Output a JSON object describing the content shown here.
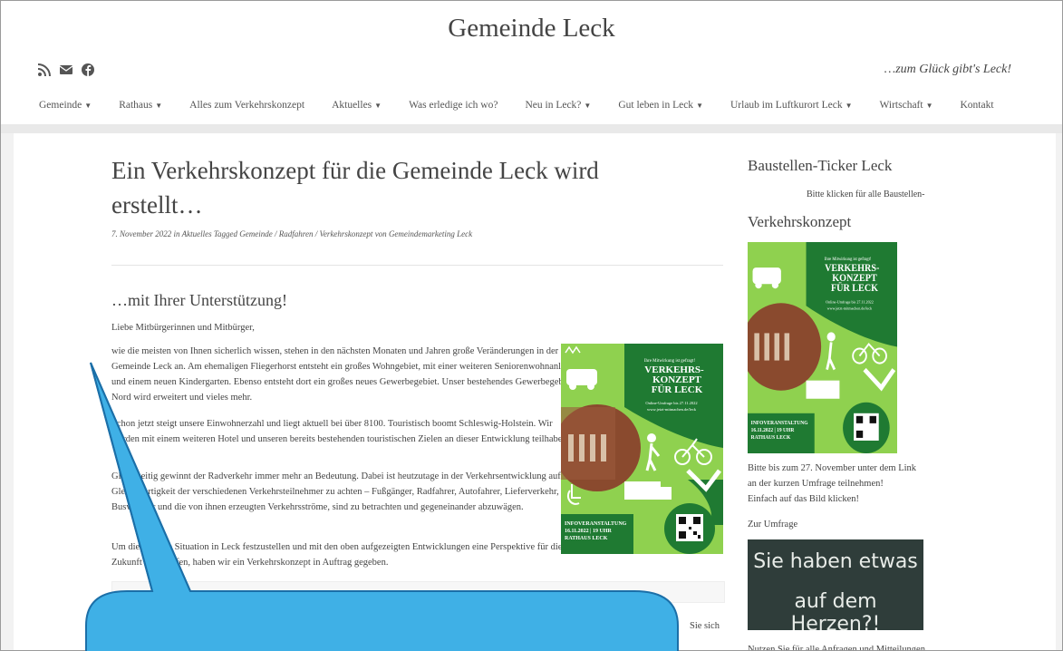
{
  "site": {
    "title": "Gemeinde Leck",
    "slogan": "…zum Glück gibt's Leck!"
  },
  "social": {
    "icons": [
      "rss-icon",
      "mail-icon",
      "facebook-icon"
    ]
  },
  "nav": [
    {
      "label": "Gemeinde",
      "dropdown": true
    },
    {
      "label": "Rathaus",
      "dropdown": true
    },
    {
      "label": "Alles zum Verkehrskonzept",
      "dropdown": false
    },
    {
      "label": "Aktuelles",
      "dropdown": true
    },
    {
      "label": "Was erledige ich wo?",
      "dropdown": false
    },
    {
      "label": "Neu in Leck?",
      "dropdown": true
    },
    {
      "label": "Gut leben in Leck",
      "dropdown": true
    },
    {
      "label": "Urlaub im Luftkurort Leck",
      "dropdown": true
    },
    {
      "label": "Wirtschaft",
      "dropdown": true
    },
    {
      "label": "Kontakt",
      "dropdown": false
    }
  ],
  "post": {
    "title": "Ein Verkehrskonzept für die Gemeinde Leck wird erstellt…",
    "meta": {
      "date": "7. November 2022",
      "in_label": "in",
      "category": "Aktuelles",
      "tagged_label": "Tagged",
      "tags": "Gemeinde / Radfahren / Verkehrskonzept",
      "by_label": "von",
      "author": "Gemeindemarketing Leck"
    },
    "subheading": "…mit Ihrer Unterstützung!",
    "greeting": "Liebe Mitbürgerinnen und Mitbürger,",
    "p1": "wie die meisten von Ihnen sicherlich wissen, stehen in den nächsten Monaten und Jahren große Veränderungen in der Gemeinde Leck an. Am ehemaligen Fliegerhorst entsteht ein großes Wohngebiet, mit einer weiteren Seniorenwohnanlage und einem neuen Kindergarten. Ebenso entsteht dort ein großes neues Gewerbegebiet. Unser bestehendes Gewerbegebiet Nord wird erweitert und vieles mehr.",
    "p2": "Schon jetzt steigt unsere Einwohnerzahl und liegt aktuell bei über 8100. Touristisch boomt Schleswig-Holstein. Wir werden mit einem weiteren Hotel und unseren bereits bestehenden touristischen Zielen an dieser Entwicklung teilhaben.",
    "p3": "Gleichzeitig gewinnt der Radverkehr immer mehr an Bedeutung. Dabei ist heutzutage in der Verkehrsentwicklung auf die Gleichwertigkeit der verschiedenen Verkehrsteilnehmer zu achten – Fußgänger, Radfahrer, Autofahrer, Lieferverkehr, Busverkehr und die von ihnen erzeugten Verkehrsströme, sind zu betrachten und gegeneinander abzuwägen.",
    "p4": "Um die aktuelle Situation in Leck festzustellen und mit den oben aufgezeigten Entwicklungen eine Perspektive für die Zukunft zu schaffen, haben wir ein Verkehrskonzept in Auftrag gegeben.",
    "trailing": "Sie sich"
  },
  "poster": {
    "line1": "Ihre Mitwirkung ist gefragt!",
    "headline1": "VERKEHRS-",
    "headline2": "KONZEPT",
    "headline3": "FÜR LECK",
    "online1": "Online-Umfrage bis 27.11.2022",
    "online2": "www.jetzt-mitmachen.de/leck",
    "event1": "INFOVERANSTALTUNG",
    "event2": "16.11.2022 | 19 UHR",
    "event3": "RATHAUS LECK"
  },
  "sidebar": {
    "ticker_title": "Baustellen-Ticker Leck",
    "ticker_text": "Bitte klicken für alle Baustellen-",
    "vk_title": "Verkehrskonzept",
    "umfrage1": "Bitte bis zum 27. November unter dem Link",
    "umfrage2": "an der kurzen Umfrage teilnehmen!",
    "umfrage3": "Einfach auf das Bild klicken!",
    "umfrage_link": "Zur Umfrage",
    "chalk_line1": "Sie haben etwas",
    "chalk_line2": "auf dem Herzen?!",
    "footer_text": "Nutzen Sie für alle Anfragen und Mitteilungen"
  },
  "colors": {
    "poster_green": "#8fd14f",
    "dark_green": "#1f7a32",
    "callout": "#3fb0e6",
    "chalkboard": "#2f3d3a"
  }
}
